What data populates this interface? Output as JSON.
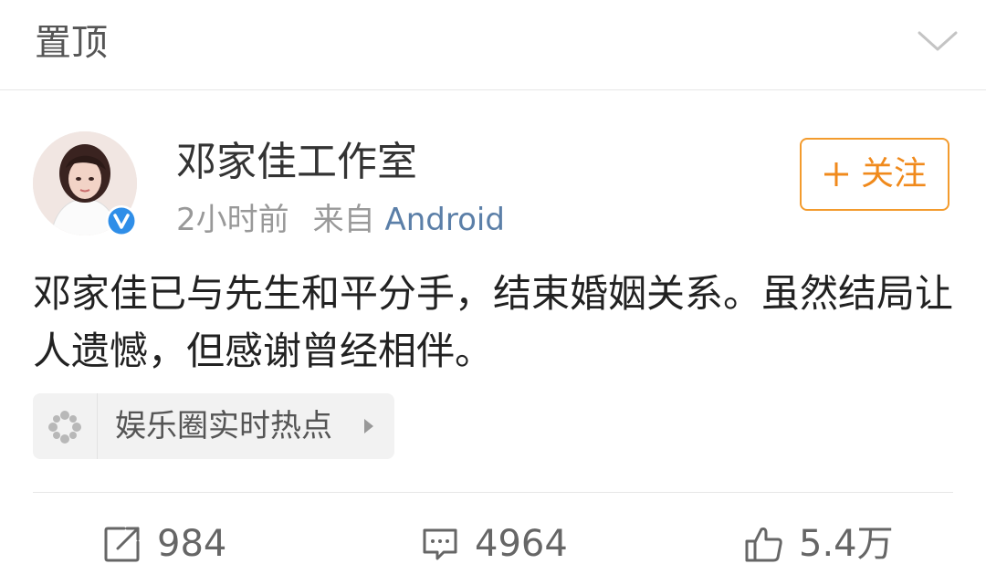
{
  "topbar": {
    "title": "置顶"
  },
  "post": {
    "username": "邓家佳工作室",
    "time": "2小时前",
    "source_prefix": "来自",
    "source_device": "Android",
    "follow_label": "关注",
    "text": "邓家佳已与先生和平分手，结束婚姻关系。虽然结局让人遗憾，但感谢曾经相伴。",
    "topic": "娱乐圈实时热点"
  },
  "actions": {
    "repost_count": "984",
    "comment_count": "4964",
    "like_count": "5.4万"
  },
  "colors": {
    "accent_orange": "#f08a1c",
    "verified_blue": "#2f8ee8",
    "link_blue": "#5b7fa8"
  }
}
